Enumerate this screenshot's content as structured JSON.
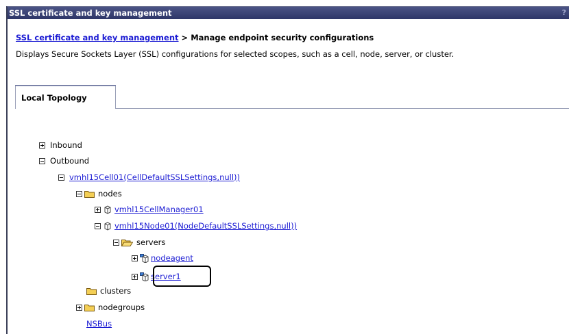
{
  "window": {
    "title": "SSL certificate and key management",
    "help_glyph": "?"
  },
  "breadcrumb": {
    "link": "SSL certificate and key management",
    "separator": " > ",
    "current": "Manage endpoint security configurations"
  },
  "description": "Displays Secure Sockets Layer (SSL) configurations for selected scopes, such as a cell, node, server, or cluster.",
  "tabs": [
    {
      "label": "Local Topology"
    }
  ],
  "tree": {
    "inbound": "Inbound",
    "outbound": "Outbound",
    "cell": "vmhl15Cell01(CellDefaultSSLSettings,null))",
    "nodes": "nodes",
    "cell_manager": "vmhl15CellManager01",
    "node": "vmhl15Node01(NodeDefaultSSLSettings,null))",
    "servers": "servers",
    "nodeagent": "nodeagent",
    "server1": "server1",
    "clusters": "clusters",
    "nodegroups": "nodegroups",
    "nsbus": "NSBus"
  },
  "colors": {
    "titlebar": "#2d3567",
    "link": "#1b1bd3",
    "folder": "#f2c94c"
  }
}
